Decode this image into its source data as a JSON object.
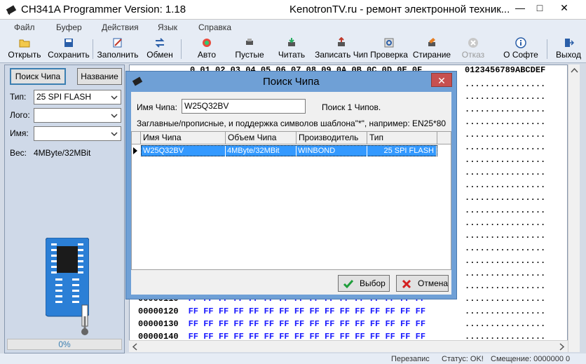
{
  "window": {
    "title": "CH341A Programmer Version: 1.18",
    "title_right": "KenotronTV.ru - ремонт электронной техник...",
    "minimize": "—",
    "maximize": "□",
    "close": "✕"
  },
  "menu": {
    "file": "Файл",
    "buffer": "Буфер",
    "actions": "Действия",
    "language": "Язык",
    "help": "Справка"
  },
  "toolbar": {
    "open": "Открыть",
    "save": "Сохранить",
    "fill": "Заполнить",
    "swap": "Обмен",
    "auto": "Авто",
    "blank": "Пустые",
    "read": "Читать",
    "write": "Записать Чип",
    "verify": "Проверка",
    "erase": "Стирание",
    "cancel": "Отказ",
    "about": "О Софте",
    "exit": "Выход"
  },
  "left_panel": {
    "search_chip_button": "Поиск Чипа",
    "name_button": "Название",
    "type_label": "Тип:",
    "type_value": "25 SPI FLASH",
    "logo_label": "Лого:",
    "logo_value": "",
    "name_label": "Имя:",
    "name_value": "",
    "size_label": "Вес:",
    "size_value": "4MByte/32MBit",
    "progress": "0%"
  },
  "hex": {
    "header": "0 01 02 03 04 05 06 07 08 09 0A 0B 0C 0D 0E 0F",
    "ascii_header": "0123456789ABCDEF",
    "rows": [
      {
        "addr": "00000110",
        "bytes": "FF FF FF FF FF FF FF FF FF FF FF FF FF FF FF FF"
      },
      {
        "addr": "00000120",
        "bytes": "FF FF FF FF FF FF FF FF FF FF FF FF FF FF FF FF"
      },
      {
        "addr": "00000130",
        "bytes": "FF FF FF FF FF FF FF FF FF FF FF FF FF FF FF FF"
      },
      {
        "addr": "00000140",
        "bytes": "FF FF FF FF FF FF FF FF FF FF FF FF FF FF FF FF"
      }
    ],
    "ascii_row": "................"
  },
  "status": {
    "rewrite": "Перезапис",
    "state": "Статус: OK!",
    "offset": "Смещение: 0000000 0"
  },
  "dialog": {
    "title": "Поиск Чипа",
    "close": "✕",
    "chip_name_label": "Имя Чипа:",
    "chip_name_value": "W25Q32BV",
    "found_text": "Поиск 1 Чипов.",
    "hint": "Заглавные/прописные, и поддержка символов шаблона\"*\", например: EN25*80",
    "columns": [
      "Имя Чипа",
      "Объем Чипа",
      "Производитель",
      "Тип"
    ],
    "rows": [
      {
        "name": "W25Q32BV",
        "size": "4MByte/32MBit",
        "vendor": "WINBOND",
        "type": "25 SPI FLASH"
      }
    ],
    "select_button": "Выбор",
    "cancel_button": "Отмена"
  }
}
